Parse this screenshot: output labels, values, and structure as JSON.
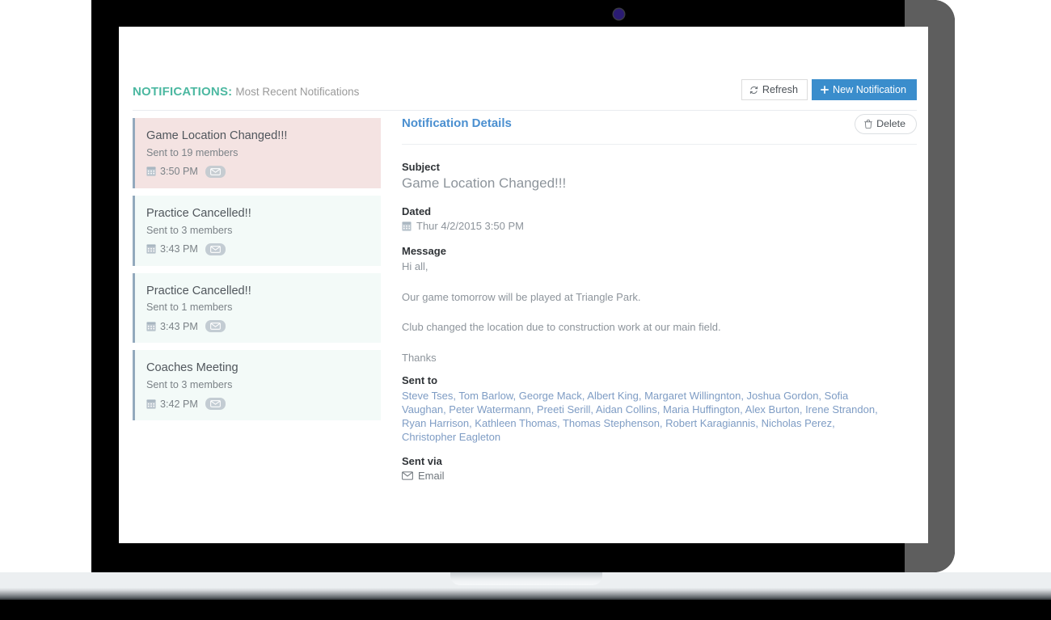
{
  "device": {
    "webcam_icon": "webcam-dot-icon",
    "accent_blue": "#3a8dcc"
  },
  "header": {
    "title": "NOTIFICATIONS:",
    "subtitle": "Most Recent Notifications",
    "title_color": "#4cb8a1",
    "refresh_label": "Refresh",
    "refresh_icon": "refresh-icon",
    "new_notification_label": "New Notification",
    "new_notification_icon": "plus-icon"
  },
  "notification_list": [
    {
      "title": "Game Location Changed!!!",
      "sent_to": "Sent to 19 members",
      "time": "3:50 PM",
      "calendar_icon": "calendar-icon",
      "channel_icon": "envelope-icon",
      "selected": true
    },
    {
      "title": "Practice Cancelled!!",
      "sent_to": "Sent to 3 members",
      "time": "3:43 PM",
      "calendar_icon": "calendar-icon",
      "channel_icon": "envelope-icon",
      "selected": false
    },
    {
      "title": "Practice Cancelled!!",
      "sent_to": "Sent to 1 members",
      "time": "3:43 PM",
      "calendar_icon": "calendar-icon",
      "channel_icon": "envelope-icon",
      "selected": false
    },
    {
      "title": "Coaches Meeting",
      "sent_to": "Sent to 3 members",
      "time": "3:42 PM",
      "calendar_icon": "calendar-icon",
      "channel_icon": "envelope-icon",
      "selected": false
    }
  ],
  "details": {
    "title": "Notification Details",
    "delete_label": "Delete",
    "delete_icon": "trash-icon",
    "subject_label": "Subject",
    "subject_value": "Game Location Changed!!!",
    "dated_label": "Dated",
    "dated_value": "Thur 4/2/2015 3:50 PM",
    "dated_icon": "calendar-icon",
    "message_label": "Message",
    "message_lines": [
      "Hi all,",
      "Our game tomorrow will be played at Triangle Park.",
      "Club changed the location due to construction work at our main field.",
      "Thanks"
    ],
    "sent_to_label": "Sent to",
    "sent_to_value": "Steve Tses, Tom Barlow, George Mack, Albert King, Margaret Willingnton, Joshua Gordon, Sofia Vaughan, Peter Watermann, Preeti Serill, Aidan Collins, Maria Huffington, Alex Burton, Irene Strandon, Ryan Harrison, Kathleen Thomas, Thomas Stephenson, Robert Karagiannis, Nicholas Perez, Christopher Eagleton",
    "sent_via_label": "Sent via",
    "sent_via_value": "Email",
    "sent_via_icon": "envelope-icon"
  }
}
